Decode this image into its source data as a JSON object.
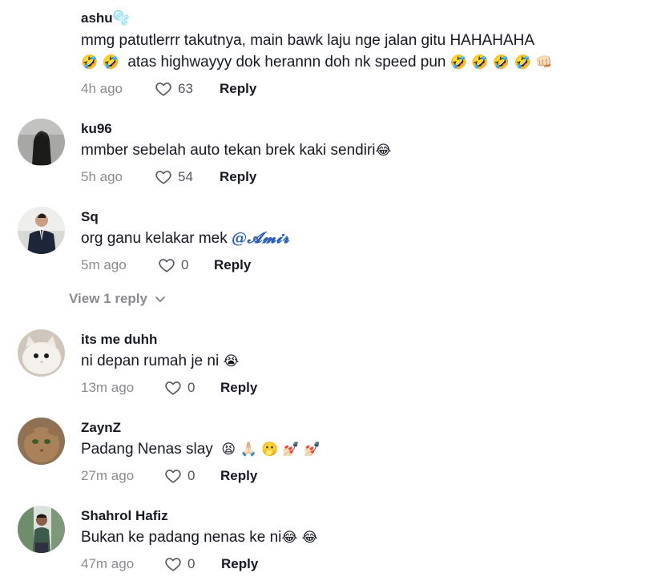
{
  "comments": [
    {
      "username": "ashu",
      "username_badge": "🫧",
      "text_line1": "mmg patutlerrr takutnya, main bawk laju nge jalan gitu HAHAHAHA",
      "text_line2_emoji_a": "🤣 🤣",
      "text_line2": "atas highwayyy dok herannn doh nk speed pun",
      "text_line2_emoji_b": "🤣 🤣 🤣 🤣 👊🏻",
      "time": "4h ago",
      "likes": "63",
      "reply_label": "Reply"
    },
    {
      "username": "ku96",
      "text": "mmber sebelah auto tekan brek kaki sendiri",
      "emoji": "😂",
      "time": "5h ago",
      "likes": "54",
      "reply_label": "Reply"
    },
    {
      "username": "Sq",
      "text": "org ganu kelakar mek",
      "mention": "@𝓐𝓶𝓲𝓻",
      "time": "5m ago",
      "likes": "0",
      "reply_label": "Reply",
      "view_replies": "View 1 reply"
    },
    {
      "username": "its me duhh",
      "text": "ni depan rumah je ni",
      "emoji": "😭",
      "time": "13m ago",
      "likes": "0",
      "reply_label": "Reply"
    },
    {
      "username": "ZaynZ",
      "text": "Padang Nenas slay",
      "emoji": "😫 🙏🏻 🫢 💅🏻 💅🏻",
      "time": "27m ago",
      "likes": "0",
      "reply_label": "Reply"
    },
    {
      "username": "Shahrol Hafiz",
      "text": "Bukan ke padang nenas ke ni",
      "emoji": "😂 😂",
      "time": "47m ago",
      "likes": "0",
      "reply_label": "Reply"
    }
  ],
  "icons": {
    "like": "heart-outline-icon",
    "expand": "chevron-down-icon"
  },
  "colors": {
    "text": "#161823",
    "meta": "#8a8b91",
    "mention": "#2b5db9"
  }
}
